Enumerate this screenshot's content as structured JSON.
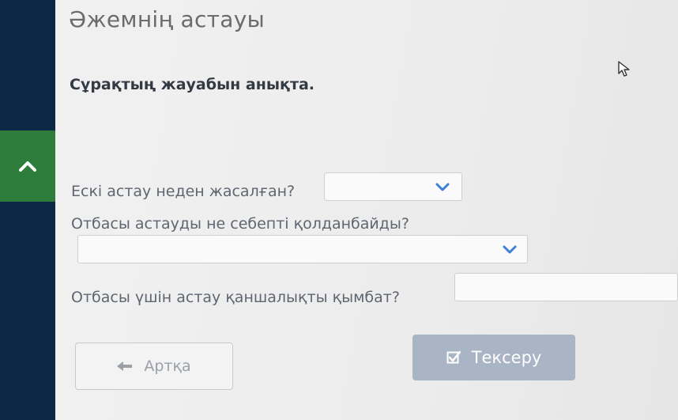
{
  "page": {
    "title": "Әжемнің астауы",
    "instruction": "Сұрақтың жауабын анықта."
  },
  "questions": [
    {
      "label": "Ескі астау неден жасалған?",
      "selected": ""
    },
    {
      "label": "Отбасы астауды не себепті қолданбайды?",
      "selected": ""
    },
    {
      "label": "Отбасы үшін астау қаншалықты қымбат?",
      "selected": ""
    }
  ],
  "buttons": {
    "back_label": "Артқа",
    "check_label": "Тексеру"
  },
  "colors": {
    "sidebar": "#0b2944",
    "collapse_tab": "#2f7d3a",
    "check_button": "#a9b4c5"
  }
}
